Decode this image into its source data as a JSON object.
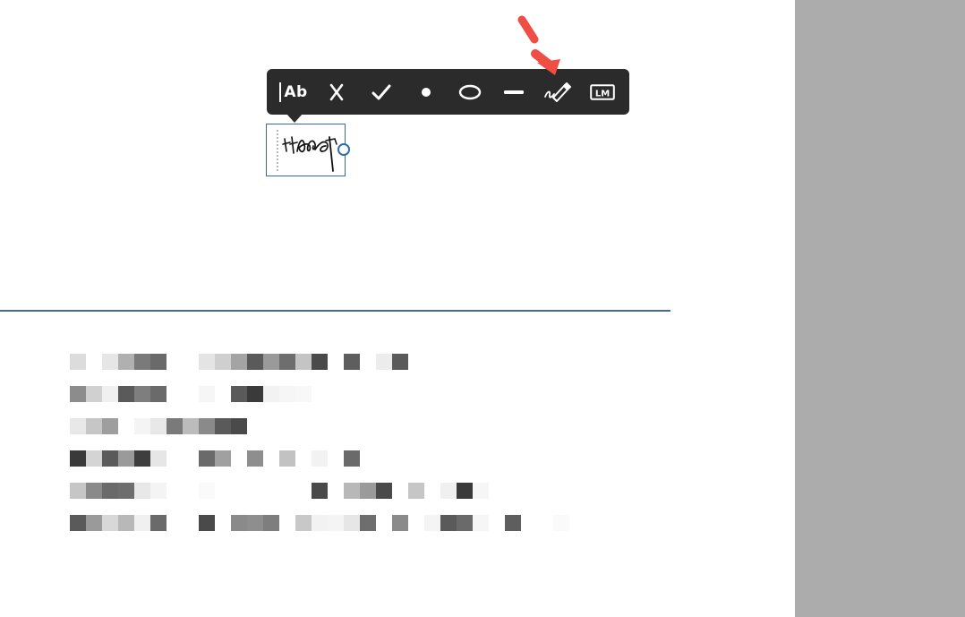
{
  "toolbar": {
    "tools": [
      {
        "id": "add-text",
        "label": "Ab",
        "icon": "text-cursor-icon"
      },
      {
        "id": "cross",
        "icon": "cross-mark-icon"
      },
      {
        "id": "check",
        "icon": "check-mark-icon"
      },
      {
        "id": "dot",
        "icon": "dot-icon"
      },
      {
        "id": "ellipse",
        "icon": "ellipse-icon"
      },
      {
        "id": "line",
        "icon": "line-icon"
      },
      {
        "id": "sign",
        "icon": "signature-pen-icon"
      },
      {
        "id": "initials",
        "label": "LM",
        "icon": "initials-icon"
      }
    ],
    "background": "#2b2b2b"
  },
  "signature_field": {
    "content": "handwritten-signature",
    "border_color": "#3a6a9a"
  },
  "annotation_arrow": {
    "color": "#f04e45",
    "points_to": "sign"
  },
  "redacted_text": {
    "line_count": 6,
    "note": ""
  },
  "colors": {
    "right_pane": "#acacac",
    "divider": "#4a6a8a"
  }
}
